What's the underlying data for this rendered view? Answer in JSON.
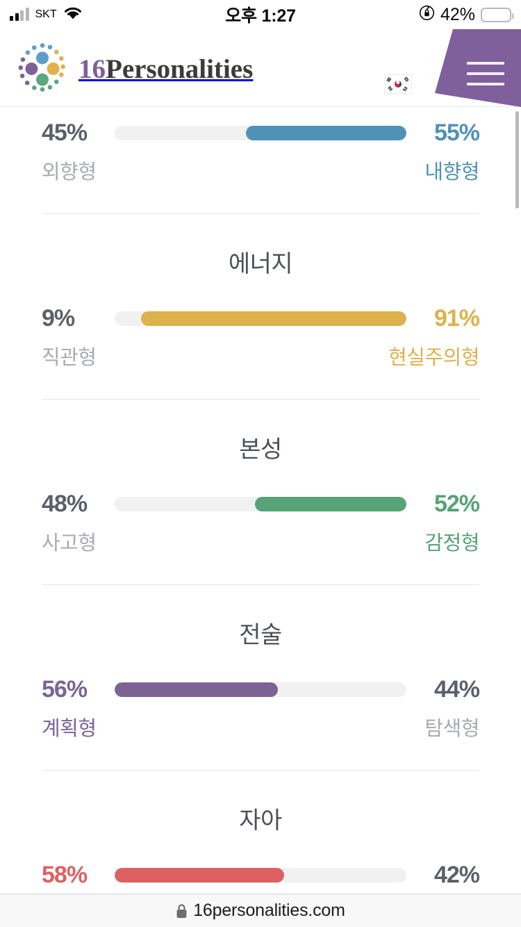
{
  "statusbar": {
    "carrier": "SKT",
    "time": "오후 1:27",
    "battery_percent": "42%",
    "battery_level": 42,
    "signal_icon": "cellular-signal-icon",
    "wifi_icon": "wifi-icon",
    "lock_icon": "rotation-lock-icon",
    "battery_icon": "battery-icon"
  },
  "header": {
    "logo_number": "16",
    "logo_word": "Personalities",
    "logo_icon": "personality-dots-logo-icon",
    "language_flag_icon": "korea-flag-icon",
    "menu_icon": "hamburger-menu-icon"
  },
  "colors": {
    "mind": "#5092b5",
    "energy": "#ddb14c",
    "nature": "#55a377",
    "tactics": "#7d6395",
    "identity": "#dd6161",
    "muted": "#a8abb0",
    "dark": "#5b6069",
    "track": "#f1f1f1",
    "brand_purple": "#7f5f9c",
    "band_blue": "#4e8eb0"
  },
  "chart_data": {
    "type": "bar",
    "title": "",
    "traits": [
      {
        "section": "",
        "left_label": "외향형",
        "left_percent": "45%",
        "left_value": 45,
        "right_label": "내향형",
        "right_percent": "55%",
        "right_value": 55,
        "dominant": "right",
        "color": "#5092b5"
      },
      {
        "section": "에너지",
        "left_label": "직관형",
        "left_percent": "9%",
        "left_value": 9,
        "right_label": "현실주의형",
        "right_percent": "91%",
        "right_value": 91,
        "dominant": "right",
        "color": "#ddb14c"
      },
      {
        "section": "본성",
        "left_label": "사고형",
        "left_percent": "48%",
        "left_value": 48,
        "right_label": "감정형",
        "right_percent": "52%",
        "right_value": 52,
        "dominant": "right",
        "color": "#55a377"
      },
      {
        "section": "전술",
        "left_label": "계획형",
        "left_percent": "56%",
        "left_value": 56,
        "right_label": "탐색형",
        "right_percent": "44%",
        "right_value": 44,
        "dominant": "left",
        "color": "#7d6395"
      },
      {
        "section": "자아",
        "left_label": "",
        "left_percent": "58%",
        "left_value": 58,
        "right_label": "",
        "right_percent": "42%",
        "right_value": 42,
        "dominant": "left",
        "color": "#dd6161"
      }
    ],
    "xlabel": "",
    "ylabel": "",
    "legend": []
  },
  "urlbar": {
    "domain": "16personalities.com",
    "lock_icon": "secure-lock-icon"
  }
}
